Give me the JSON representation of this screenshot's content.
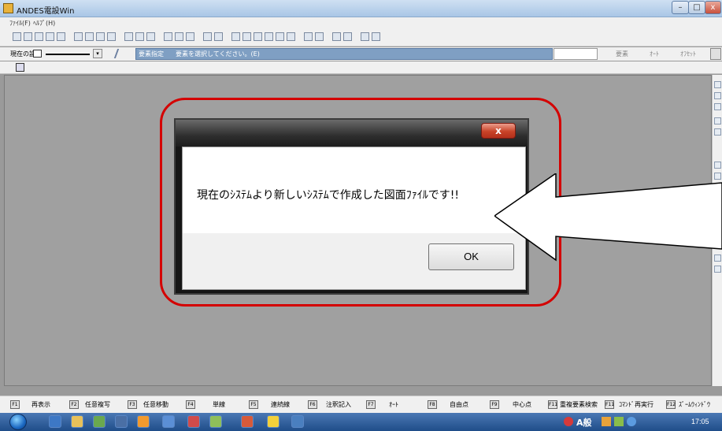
{
  "window": {
    "title": "ANDES電設Win",
    "controls": {
      "minimize": "–",
      "maximize": "□",
      "close": "x"
    }
  },
  "menu": {
    "items": [
      "ﾌｧｲﾙ(F)",
      "ﾍﾙﾌﾟ(H)"
    ]
  },
  "status_row": {
    "current_setting_label": "現在の設定",
    "mode_label": "要素指定",
    "mode_message": "要素を選択してください。(E)",
    "element_label": "要素",
    "auto_label": "ｵｰﾄ",
    "offset_label": "ｵﾌｾｯﾄ"
  },
  "dialog": {
    "close_label": "x",
    "message": "現在のｼｽﾃﾑより新しいｼｽﾃﾑで作成した図面ﾌｧｲﾙです!!",
    "ok_label": "OK"
  },
  "function_keys": [
    {
      "key": "F1",
      "label": "再表示"
    },
    {
      "key": "F2",
      "label": "任意複写"
    },
    {
      "key": "F3",
      "label": "任意移動"
    },
    {
      "key": "F4",
      "label": "単線"
    },
    {
      "key": "F5",
      "label": "連続線"
    },
    {
      "key": "F6",
      "label": "注釈記入"
    },
    {
      "key": "F7",
      "label": "ｵｰﾄ"
    },
    {
      "key": "F8",
      "label": "自由点"
    },
    {
      "key": "F9",
      "label": "中心点"
    },
    {
      "key": "F11",
      "label": "重複要素検索"
    },
    {
      "key": "F11",
      "label": "ｺﾏﾝﾄﾞ再実行"
    },
    {
      "key": "F12",
      "label": "ｽﾞｰﾑｳｨﾝﾄﾞｳ"
    }
  ],
  "taskbar": {
    "ime_label": "A般",
    "clock": "17:05"
  },
  "colors": {
    "highlight": "#d40000",
    "mode_bar": "#7f9fc3",
    "dialog_close": "#c84328"
  }
}
